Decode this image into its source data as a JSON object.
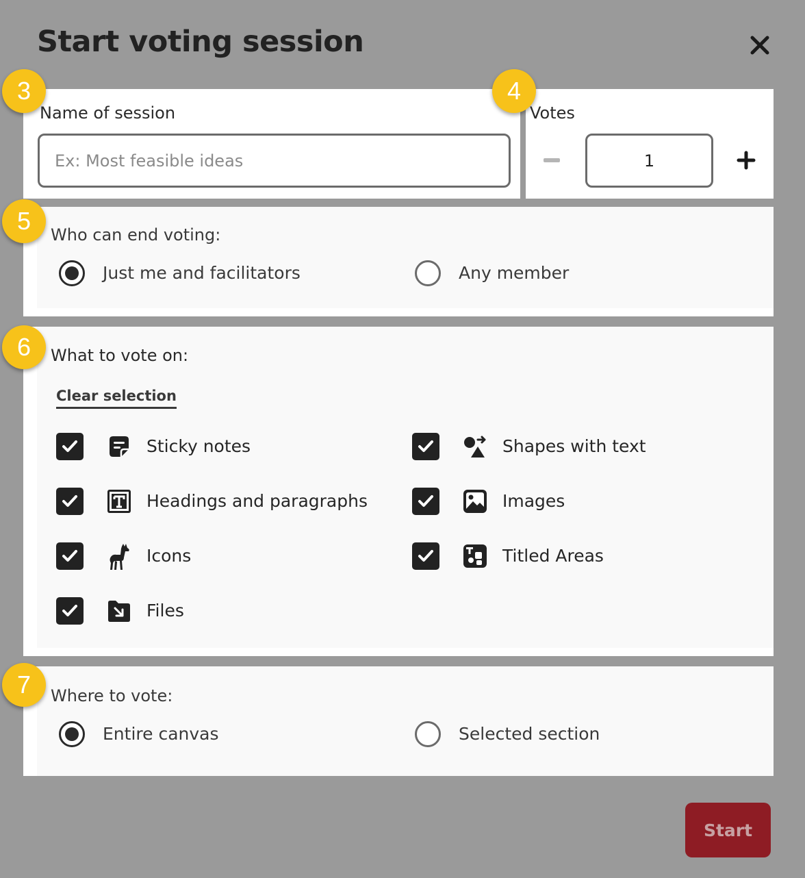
{
  "dialog": {
    "title": "Start voting session",
    "close_icon": "close-icon"
  },
  "badges": [
    "3",
    "4",
    "5",
    "6",
    "7"
  ],
  "session_name": {
    "label": "Name of session",
    "value": "",
    "placeholder": "Ex: Most feasible ideas"
  },
  "votes": {
    "label": "Votes",
    "value": "1",
    "decrement_icon": "minus-icon",
    "increment_icon": "plus-icon"
  },
  "end_voting": {
    "label": "Who can end voting:",
    "options": [
      {
        "label": "Just me and facilitators",
        "selected": true
      },
      {
        "label": "Any member",
        "selected": false
      }
    ]
  },
  "vote_on": {
    "label": "What to vote on:",
    "clear_label": "Clear selection",
    "items": [
      {
        "label": "Sticky notes",
        "checked": true,
        "icon": "sticky-note-icon"
      },
      {
        "label": "Shapes with text",
        "checked": true,
        "icon": "shapes-icon"
      },
      {
        "label": "Headings and paragraphs",
        "checked": true,
        "icon": "text-icon"
      },
      {
        "label": "Images",
        "checked": true,
        "icon": "image-icon"
      },
      {
        "label": "Icons",
        "checked": true,
        "icon": "llama-icon"
      },
      {
        "label": "Titled Areas",
        "checked": true,
        "icon": "titled-area-icon"
      },
      {
        "label": "Files",
        "checked": true,
        "icon": "file-icon"
      }
    ]
  },
  "where": {
    "label": "Where to vote:",
    "options": [
      {
        "label": "Entire canvas",
        "selected": true
      },
      {
        "label": "Selected section",
        "selected": false
      }
    ]
  },
  "footer": {
    "start_label": "Start"
  },
  "colors": {
    "backdrop": "#9a9a9a",
    "badge": "#f7c21a",
    "start_button": "#8e1c24"
  }
}
